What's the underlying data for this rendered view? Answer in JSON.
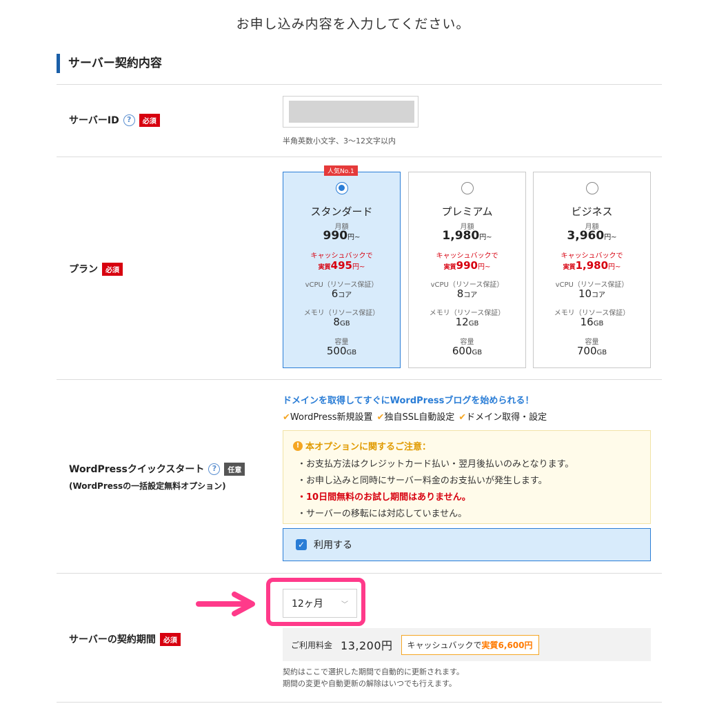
{
  "page": {
    "heading": "お申し込み内容を入力してください。"
  },
  "section": {
    "title": "サーバー契約内容"
  },
  "server_id": {
    "label": "サーバーID",
    "help_icon": "question-circle-icon",
    "badge": "必須",
    "hint": "半角英数小文字、3〜12文字以内"
  },
  "plan": {
    "label": "プラン",
    "badge": "必須",
    "popular_badge": "人気No.1",
    "cards": [
      {
        "name": "スタンダード",
        "monthly_label": "月額",
        "price": "990",
        "price_unit": "円~",
        "cashback_note": "キャッシュバックで",
        "real_prefix": "実質",
        "real_price": "495",
        "real_unit": "円~",
        "cpu_label": "vCPU（リソース保証）",
        "cpu_value": "6",
        "cpu_unit": "コア",
        "mem_label": "メモリ（リソース保証）",
        "mem_value": "8",
        "mem_unit": "GB",
        "disk_label": "容量",
        "disk_value": "500",
        "disk_unit": "GB",
        "selected": true
      },
      {
        "name": "プレミアム",
        "monthly_label": "月額",
        "price": "1,980",
        "price_unit": "円~",
        "cashback_note": "キャッシュバックで",
        "real_prefix": "実質",
        "real_price": "990",
        "real_unit": "円~",
        "cpu_label": "vCPU（リソース保証）",
        "cpu_value": "8",
        "cpu_unit": "コア",
        "mem_label": "メモリ（リソース保証）",
        "mem_value": "12",
        "mem_unit": "GB",
        "disk_label": "容量",
        "disk_value": "600",
        "disk_unit": "GB",
        "selected": false
      },
      {
        "name": "ビジネス",
        "monthly_label": "月額",
        "price": "3,960",
        "price_unit": "円~",
        "cashback_note": "キャッシュバックで",
        "real_prefix": "実質",
        "real_price": "1,980",
        "real_unit": "円~",
        "cpu_label": "vCPU（リソース保証）",
        "cpu_value": "10",
        "cpu_unit": "コア",
        "mem_label": "メモリ（リソース保証）",
        "mem_value": "16",
        "mem_unit": "GB",
        "disk_label": "容量",
        "disk_value": "700",
        "disk_unit": "GB",
        "selected": false
      }
    ]
  },
  "wordpress": {
    "label": "WordPressクイックスタート",
    "badge": "任意",
    "sub_label": "(WordPressの一括設定無料オプション)",
    "promo": "ドメインを取得してすぐにWordPressブログを始められる！",
    "features": [
      "WordPress新規設置",
      "独自SSL自動設定",
      "ドメイン取得・設定"
    ],
    "notice_title": "本オプションに関するご注意：",
    "notice_items": [
      "・お支払方法はクレジットカード払い・翌月後払いのみとなります。",
      "・お申し込みと同時にサーバー料金のお支払いが発生します。",
      "・10日間無料のお試し期間はありません。",
      "・サーバーの移転には対応していません。"
    ],
    "use_label": "利用する",
    "use_checked": true
  },
  "period": {
    "label": "サーバーの契約期間",
    "badge": "必須",
    "selected": "12ヶ月",
    "price_label": "ご利用料金",
    "price_value": "13,200円",
    "cashback_prefix": "キャッシュバックで",
    "cashback_value": "実質6,600円",
    "note_line1": "契約はここで選択した期間で自動的に更新されます。",
    "note_line2": "期間の変更や自動更新の解除はいつでも行えます。"
  },
  "colors": {
    "accent_blue": "#2a7dd6",
    "required_red": "#d7000f",
    "highlight_pink": "#ff3a8a",
    "cashback_orange": "#ff7a00"
  }
}
